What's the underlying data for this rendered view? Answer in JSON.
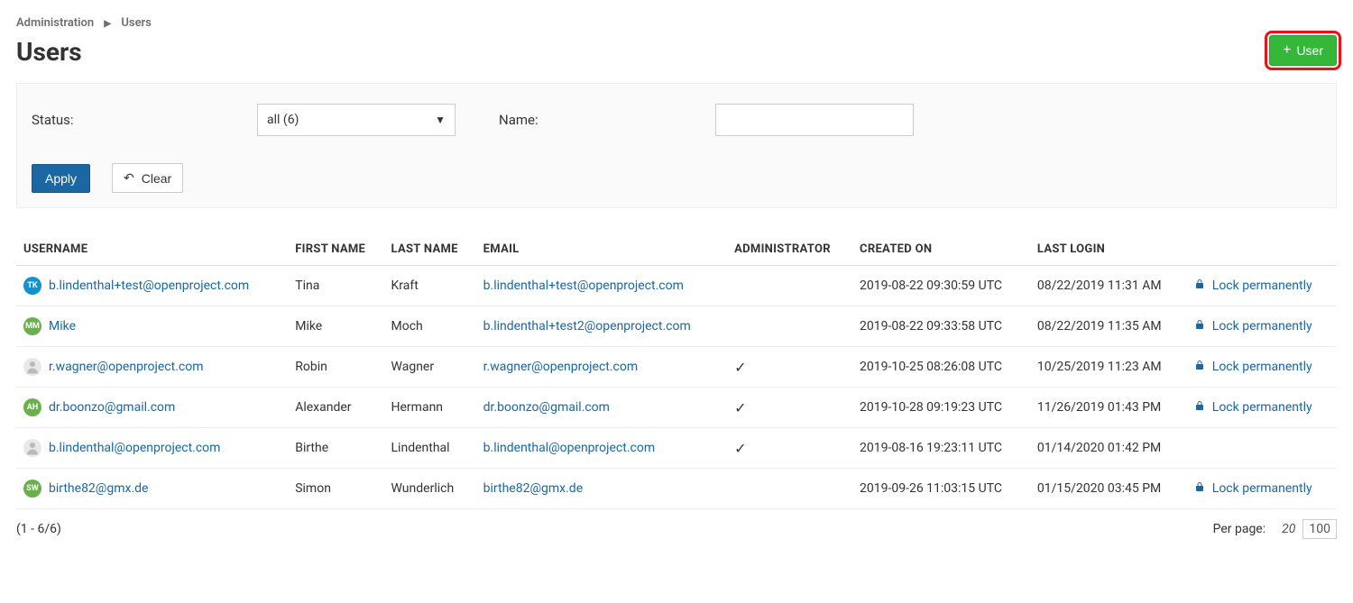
{
  "breadcrumb": {
    "root": "Administration",
    "current": "Users"
  },
  "page": {
    "title": "Users"
  },
  "header": {
    "add_user_label": "User"
  },
  "filter": {
    "status_label": "Status:",
    "status_selected": "all (6)",
    "name_label": "Name:",
    "name_value": "",
    "apply_label": "Apply",
    "clear_label": "Clear"
  },
  "table": {
    "headers": {
      "username": "USERNAME",
      "first_name": "FIRST NAME",
      "last_name": "LAST NAME",
      "email": "EMAIL",
      "administrator": "ADMINISTRATOR",
      "created_on": "CREATED ON",
      "last_login": "LAST LOGIN"
    },
    "lock_label": "Lock permanently",
    "rows": [
      {
        "avatar_initials": "TK",
        "avatar_type": "initials",
        "avatar_color": "#1292d0",
        "username": "b.lindenthal+test@openproject.com",
        "first_name": "Tina",
        "last_name": "Kraft",
        "email": "b.lindenthal+test@openproject.com",
        "administrator": false,
        "created_on": "2019-08-22 09:30:59 UTC",
        "last_login": "08/22/2019 11:31 AM",
        "lockable": true
      },
      {
        "avatar_initials": "MM",
        "avatar_type": "initials",
        "avatar_color": "#6ab04c",
        "username": "Mike",
        "first_name": "Mike",
        "last_name": "Moch",
        "email": "b.lindenthal+test2@openproject.com",
        "administrator": false,
        "created_on": "2019-08-22 09:33:58 UTC",
        "last_login": "08/22/2019 11:35 AM",
        "lockable": true
      },
      {
        "avatar_initials": "",
        "avatar_type": "photo",
        "avatar_color": "#dddddd",
        "username": "r.wagner@openproject.com",
        "first_name": "Robin",
        "last_name": "Wagner",
        "email": "r.wagner@openproject.com",
        "administrator": true,
        "created_on": "2019-10-25 08:26:08 UTC",
        "last_login": "10/25/2019 11:23 AM",
        "lockable": true
      },
      {
        "avatar_initials": "AH",
        "avatar_type": "initials",
        "avatar_color": "#6ab04c",
        "username": "dr.boonzo@gmail.com",
        "first_name": "Alexander",
        "last_name": "Hermann",
        "email": "dr.boonzo@gmail.com",
        "administrator": true,
        "created_on": "2019-10-28 09:19:23 UTC",
        "last_login": "11/26/2019 01:43 PM",
        "lockable": true
      },
      {
        "avatar_initials": "",
        "avatar_type": "photo",
        "avatar_color": "#dddddd",
        "username": "b.lindenthal@openproject.com",
        "first_name": "Birthe",
        "last_name": "Lindenthal",
        "email": "b.lindenthal@openproject.com",
        "administrator": true,
        "created_on": "2019-08-16 19:23:11 UTC",
        "last_login": "01/14/2020 01:42 PM",
        "lockable": false
      },
      {
        "avatar_initials": "SW",
        "avatar_type": "initials",
        "avatar_color": "#6ab04c",
        "username": "birthe82@gmx.de",
        "first_name": "Simon",
        "last_name": "Wunderlich",
        "email": "birthe82@gmx.de",
        "administrator": false,
        "created_on": "2019-09-26 11:03:15 UTC",
        "last_login": "01/15/2020 03:45 PM",
        "lockable": true
      }
    ]
  },
  "footer": {
    "range": "(1 - 6/6)",
    "per_page_label": "Per page:",
    "per_page_options": [
      "20",
      "100"
    ],
    "per_page_active": "20"
  }
}
